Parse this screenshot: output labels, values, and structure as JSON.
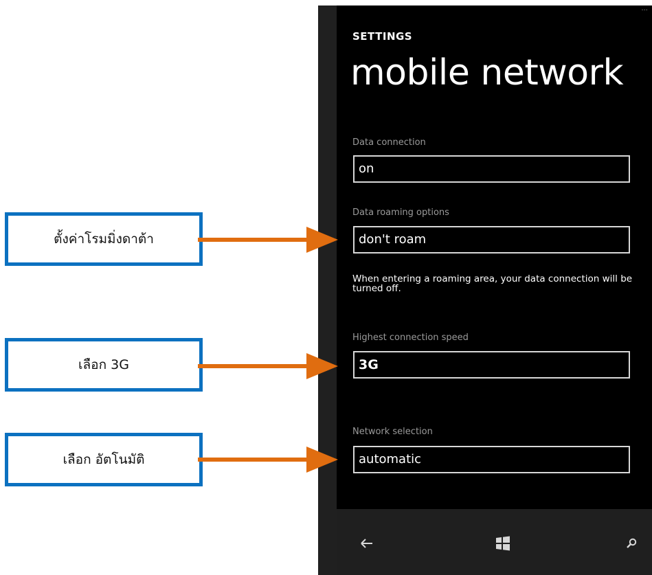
{
  "screen": {
    "eyebrow": "SETTINGS",
    "title": "mobile network"
  },
  "fields": [
    {
      "label": "Data connection",
      "value": "on"
    },
    {
      "label": "Data roaming options",
      "value": "don't roam"
    },
    {
      "label": "Highest connection speed",
      "value": "3G"
    },
    {
      "label": "Network selection",
      "value": "automatic"
    }
  ],
  "help_text": "When entering a roaming area, your data connection will be turned off.",
  "appbar": {
    "icons": [
      "back-arrow-icon",
      "windows-start-icon",
      "search-icon"
    ]
  },
  "callouts": [
    {
      "text": "ตั้งค่าโรมมิ่งดาต้า"
    },
    {
      "text": "เลือก 3G"
    },
    {
      "text": "เลือก อัตโนมัติ"
    }
  ],
  "colors": {
    "callout_border": "#0c71c0",
    "arrow": "#e06d10",
    "screen_bg": "#000000",
    "label": "#9a9a9a"
  }
}
